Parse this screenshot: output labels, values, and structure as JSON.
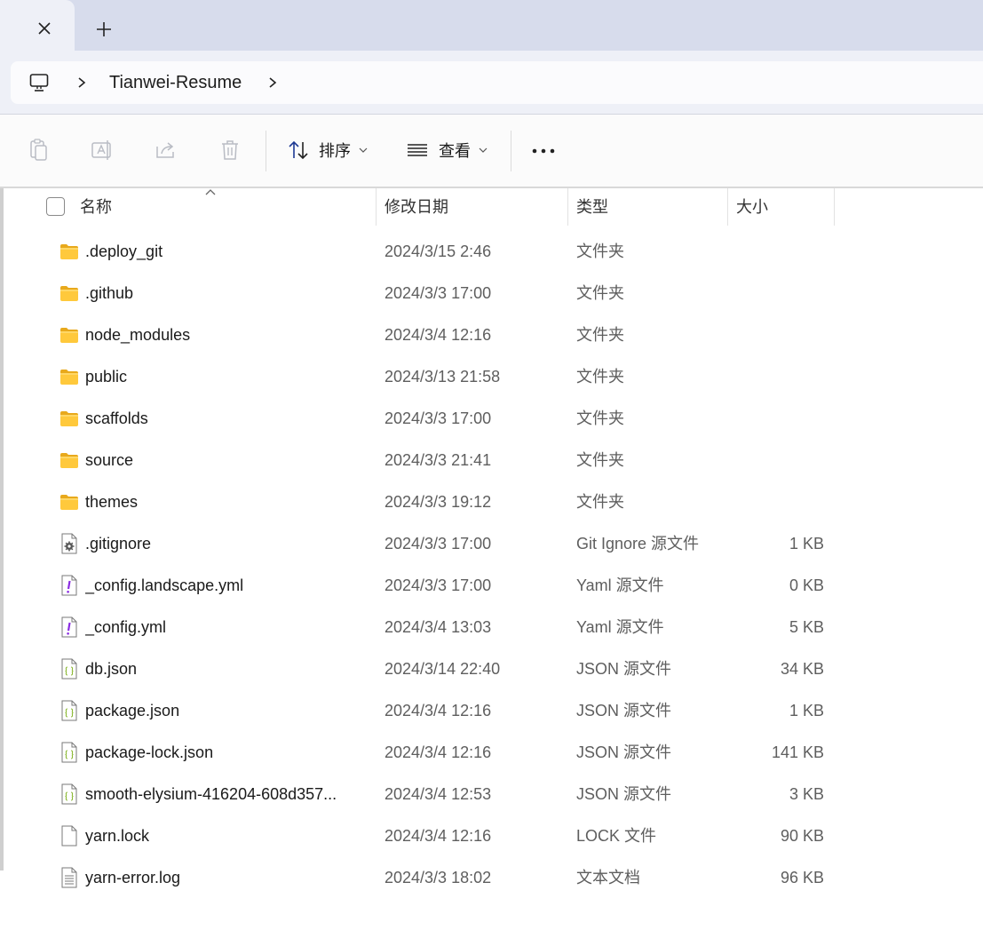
{
  "window": {
    "tab_close_icon": "close-icon",
    "new_tab_icon": "plus-icon"
  },
  "address": {
    "root_icon": "computer-icon",
    "crumbs": [
      "Tianwei-Resume"
    ]
  },
  "toolbar": {
    "sort_label": "排序",
    "view_label": "查看",
    "icons": [
      "copy-icon",
      "rename-icon",
      "share-icon",
      "delete-icon",
      "sort-icon",
      "view-icon",
      "more-icon"
    ]
  },
  "columns": {
    "name": "名称",
    "date": "修改日期",
    "type": "类型",
    "size": "大小"
  },
  "files": [
    {
      "name": ".deploy_git",
      "date": "2024/3/15 2:46",
      "type": "文件夹",
      "size": "",
      "icon": "folder"
    },
    {
      "name": ".github",
      "date": "2024/3/3 17:00",
      "type": "文件夹",
      "size": "",
      "icon": "folder"
    },
    {
      "name": "node_modules",
      "date": "2024/3/4 12:16",
      "type": "文件夹",
      "size": "",
      "icon": "folder"
    },
    {
      "name": "public",
      "date": "2024/3/13 21:58",
      "type": "文件夹",
      "size": "",
      "icon": "folder"
    },
    {
      "name": "scaffolds",
      "date": "2024/3/3 17:00",
      "type": "文件夹",
      "size": "",
      "icon": "folder"
    },
    {
      "name": "source",
      "date": "2024/3/3 21:41",
      "type": "文件夹",
      "size": "",
      "icon": "folder"
    },
    {
      "name": "themes",
      "date": "2024/3/3 19:12",
      "type": "文件夹",
      "size": "",
      "icon": "folder"
    },
    {
      "name": ".gitignore",
      "date": "2024/3/3 17:00",
      "type": "Git Ignore 源文件",
      "size": "1 KB",
      "icon": "gear-file"
    },
    {
      "name": "_config.landscape.yml",
      "date": "2024/3/3 17:00",
      "type": "Yaml 源文件",
      "size": "0 KB",
      "icon": "yaml-file"
    },
    {
      "name": "_config.yml",
      "date": "2024/3/4 13:03",
      "type": "Yaml 源文件",
      "size": "5 KB",
      "icon": "yaml-file"
    },
    {
      "name": "db.json",
      "date": "2024/3/14 22:40",
      "type": "JSON 源文件",
      "size": "34 KB",
      "icon": "json-file"
    },
    {
      "name": "package.json",
      "date": "2024/3/4 12:16",
      "type": "JSON 源文件",
      "size": "1 KB",
      "icon": "json-file"
    },
    {
      "name": "package-lock.json",
      "date": "2024/3/4 12:16",
      "type": "JSON 源文件",
      "size": "141 KB",
      "icon": "json-file"
    },
    {
      "name": "smooth-elysium-416204-608d357...",
      "date": "2024/3/4 12:53",
      "type": "JSON 源文件",
      "size": "3 KB",
      "icon": "json-file"
    },
    {
      "name": "yarn.lock",
      "date": "2024/3/4 12:16",
      "type": "LOCK 文件",
      "size": "90 KB",
      "icon": "blank-file"
    },
    {
      "name": "yarn-error.log",
      "date": "2024/3/3 18:02",
      "type": "文本文档",
      "size": "96 KB",
      "icon": "text-file"
    }
  ]
}
